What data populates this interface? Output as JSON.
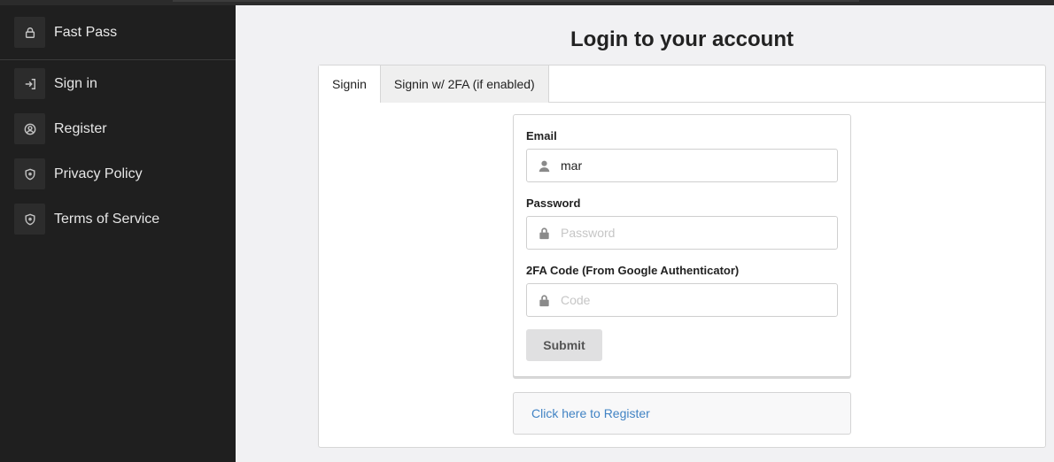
{
  "sidebar": {
    "brand": {
      "label": "Fast Pass",
      "icon": "lock-icon"
    },
    "items": [
      {
        "label": "Sign in",
        "icon": "sign-in-icon"
      },
      {
        "label": "Register",
        "icon": "user-circle-icon"
      },
      {
        "label": "Privacy Policy",
        "icon": "shield-icon"
      },
      {
        "label": "Terms of Service",
        "icon": "shield-icon"
      }
    ]
  },
  "main": {
    "title": "Login to your account",
    "tabs": [
      {
        "label": "Signin",
        "active": true
      },
      {
        "label": "Signin w/ 2FA (if enabled)",
        "active": false
      }
    ],
    "form": {
      "email": {
        "label": "Email",
        "value": "mar",
        "placeholder": "",
        "icon": "user-icon"
      },
      "password": {
        "label": "Password",
        "value": "",
        "placeholder": "Password",
        "icon": "lock-icon"
      },
      "code": {
        "label": "2FA Code (From Google Authenticator)",
        "value": "",
        "placeholder": "Code",
        "icon": "lock-icon"
      },
      "submit_label": "Submit"
    },
    "register_link": "Click here to Register"
  },
  "colors": {
    "sidebar_bg": "#1f1f1f",
    "main_bg": "#f1f1f3",
    "link": "#4183c4"
  }
}
